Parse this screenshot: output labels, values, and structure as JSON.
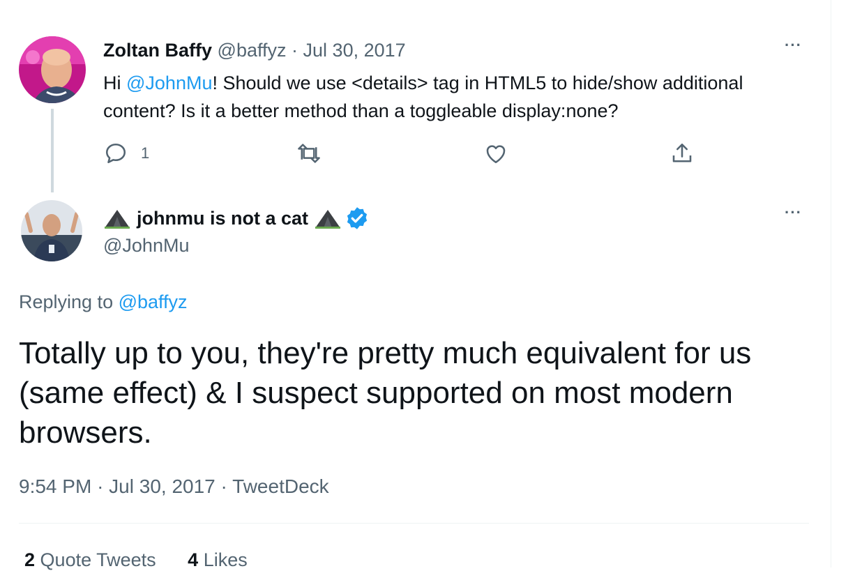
{
  "parent_tweet": {
    "name": "Zoltan Baffy",
    "handle": "@baffyz",
    "separator": "·",
    "date": "Jul 30, 2017",
    "text_before": "Hi ",
    "mention": "@JohnMu",
    "text_after": "! Should we use <details> tag in HTML5 to hide/show additional content? Is it a better method than a toggleable display:none?",
    "reply_count": "1",
    "more_label": "···"
  },
  "main_tweet": {
    "name": "johnmu is not a cat",
    "handle": "@JohnMu",
    "replying_label": "Replying to ",
    "replying_to": "@baffyz",
    "text": "Totally up to you, they're pretty much equivalent for us (same effect) & I suspect supported on most modern browsers.",
    "time": "9:54 PM",
    "date": "Jul 30, 2017",
    "source": "TweetDeck",
    "separator": "·",
    "more_label": "···"
  },
  "stats": {
    "quote_count": "2",
    "quote_label": "Quote Tweets",
    "like_count": "4",
    "like_label": "Likes"
  },
  "colors": {
    "accent": "#1d9bf0",
    "muted": "#536471",
    "verified": "#1d9bf0",
    "thread_line": "#cfd9de"
  },
  "icons": [
    "reply-icon",
    "retweet-icon",
    "like-icon",
    "share-icon",
    "mountain-icon",
    "verified-badge-icon",
    "more-icon"
  ]
}
